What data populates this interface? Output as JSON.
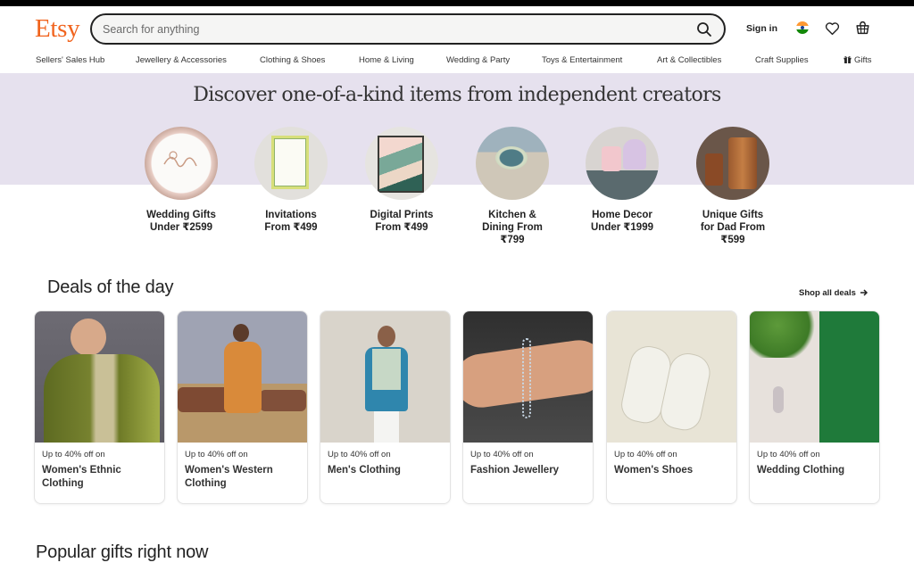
{
  "header": {
    "logo": "Etsy",
    "search_placeholder": "Search for anything",
    "search_value": "",
    "sign_in": "Sign in",
    "icons": [
      "search-icon",
      "india-flag-icon",
      "heart-icon",
      "basket-icon"
    ]
  },
  "nav": {
    "items": [
      {
        "label": "Sellers' Sales Hub"
      },
      {
        "label": "Jewellery & Accessories"
      },
      {
        "label": "Clothing & Shoes"
      },
      {
        "label": "Home & Living"
      },
      {
        "label": "Wedding & Party"
      },
      {
        "label": "Toys & Entertainment"
      },
      {
        "label": "Art & Collectibles"
      },
      {
        "label": "Craft Supplies"
      },
      {
        "label": "Gifts",
        "icon": "gift-icon"
      }
    ]
  },
  "hero": {
    "title": "Discover one-of-a-kind items from independent creators",
    "categories": [
      {
        "line1": "Wedding Gifts",
        "line2": "Under ₹2599",
        "line3": ""
      },
      {
        "line1": "Invitations",
        "line2": "From ₹499",
        "line3": ""
      },
      {
        "line1": "Digital Prints",
        "line2": "From ₹499",
        "line3": ""
      },
      {
        "line1": "Kitchen &",
        "line2": "Dining From",
        "line3": "₹799"
      },
      {
        "line1": "Home Decor",
        "line2": "Under ₹1999",
        "line3": ""
      },
      {
        "line1": "Unique Gifts",
        "line2": "for Dad From",
        "line3": "₹599"
      }
    ]
  },
  "deals": {
    "title": "Deals of the day",
    "shop_all": "Shop all deals",
    "cards": [
      {
        "prefix": "Up to 40% off on",
        "name": "Women's Ethnic Clothing"
      },
      {
        "prefix": "Up to 40% off on",
        "name": "Women's Western Clothing"
      },
      {
        "prefix": "Up to 40% off on",
        "name": "Men's Clothing"
      },
      {
        "prefix": "Up to 40% off on",
        "name": "Fashion Jewellery"
      },
      {
        "prefix": "Up to 40% off on",
        "name": "Women's Shoes"
      },
      {
        "prefix": "Up to 40% off on",
        "name": "Wedding Clothing"
      }
    ]
  },
  "popular": {
    "title": "Popular gifts right now"
  },
  "colors": {
    "brand": "#f1641e",
    "hero_bg": "#e6e1ee",
    "text": "#222222"
  }
}
